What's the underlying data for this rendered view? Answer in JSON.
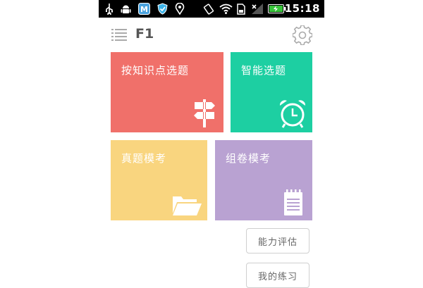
{
  "status_bar": {
    "time": "15:18",
    "icons": [
      "usb-icon",
      "android-debug-icon",
      "app-m-icon",
      "shield-icon",
      "location-icon",
      "rotate-icon",
      "wifi-icon",
      "sd-card-icon",
      "signal-icon",
      "battery-charging-icon"
    ]
  },
  "header": {
    "title": "F1",
    "menu_icon": "list-menu-icon",
    "settings_icon": "gear-icon"
  },
  "tiles": [
    {
      "label": "按知识点选题",
      "color": "#f0706a",
      "icon": "signpost-icon"
    },
    {
      "label": "智能选题",
      "color": "#1dcfa2",
      "icon": "alarm-clock-icon"
    },
    {
      "label": "真题模考",
      "color": "#f9d57f",
      "icon": "folder-icon"
    },
    {
      "label": "组卷模考",
      "color": "#b9a2d2",
      "icon": "notepad-icon"
    }
  ],
  "buttons": {
    "ability_assessment": "能力评估",
    "my_practice": "我的练习"
  }
}
